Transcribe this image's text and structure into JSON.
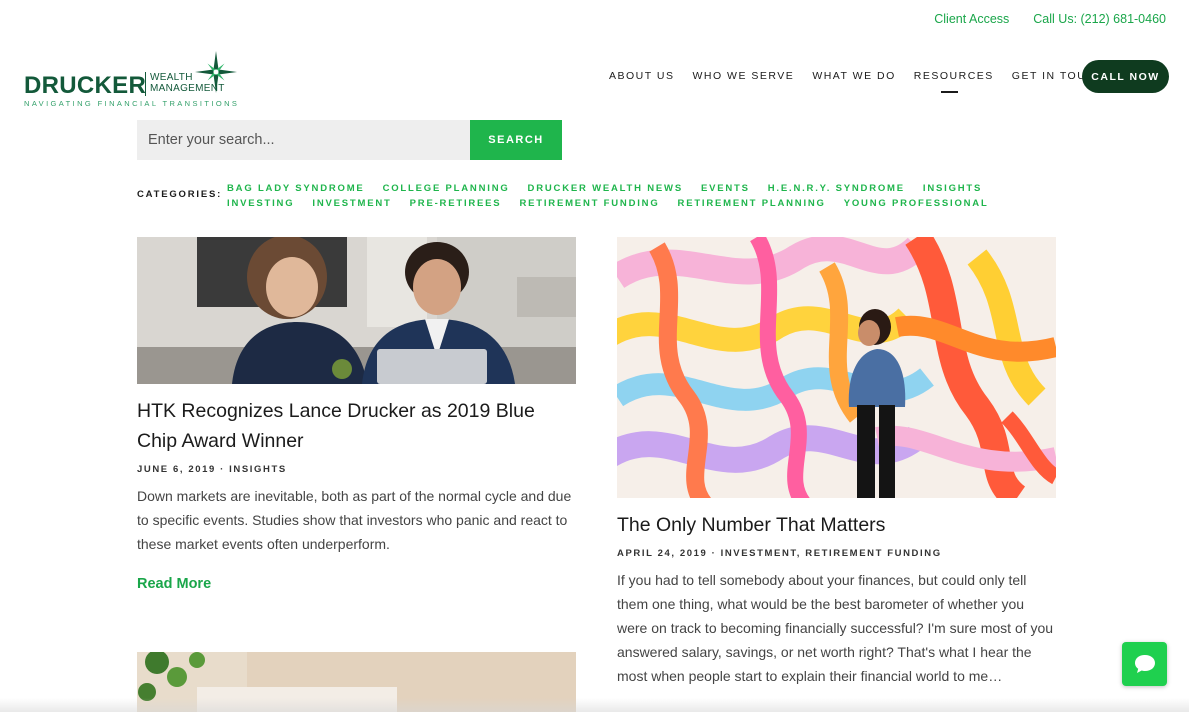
{
  "topbar": {
    "client_access": "Client Access",
    "call_us": "Call Us: (212) 681-0460"
  },
  "logo": {
    "word": "DRUCKER",
    "wealth_line1": "WEALTH",
    "wealth_line2": "MANAGEMENT",
    "tagline": "NAVIGATING FINANCIAL TRANSITIONS"
  },
  "nav": {
    "items": [
      "ABOUT US",
      "WHO WE SERVE",
      "WHAT WE DO",
      "RESOURCES",
      "GET IN TOUCH"
    ],
    "active": "RESOURCES",
    "call_now": "CALL NOW"
  },
  "search": {
    "placeholder": "Enter your search...",
    "button": "SEARCH"
  },
  "categories": {
    "label": "CATEGORIES:",
    "items": [
      "BAG LADY SYNDROME",
      "COLLEGE PLANNING",
      "DRUCKER WEALTH NEWS",
      "EVENTS",
      "H.E.N.R.Y. SYNDROME",
      "INSIGHTS",
      "INVESTING",
      "INVESTMENT",
      "PRE-RETIREES",
      "RETIREMENT FUNDING",
      "RETIREMENT PLANNING",
      "YOUNG PROFESSIONAL"
    ]
  },
  "posts": [
    {
      "title": "HTK Recognizes Lance Drucker as 2019 Blue Chip Award Winner",
      "meta": "JUNE 6, 2019 · INSIGHTS",
      "excerpt": "Down markets are inevitable, both as part of the normal cycle and due to specific events. Studies show that investors who panic and react to these market events often underperform.",
      "read_more": "Read More"
    },
    {
      "title": "The Only Number That Matters",
      "meta": "APRIL 24, 2019 · INVESTMENT, RETIREMENT FUNDING",
      "excerpt": "If you had to tell somebody about your finances, but could only tell them one thing, what would be the best barometer of whether you were on track to becoming financially successful? I'm sure most of you answered salary, savings, or net worth right? That's what I hear the most when people start to explain their financial world to me…"
    }
  ],
  "colors": {
    "brand_green": "#1fb54c",
    "dark_green": "#0f3b1f",
    "logo_green": "#13593a"
  },
  "icons": {
    "logo": "compass-star-icon",
    "chat": "chat-bubble-icon"
  }
}
